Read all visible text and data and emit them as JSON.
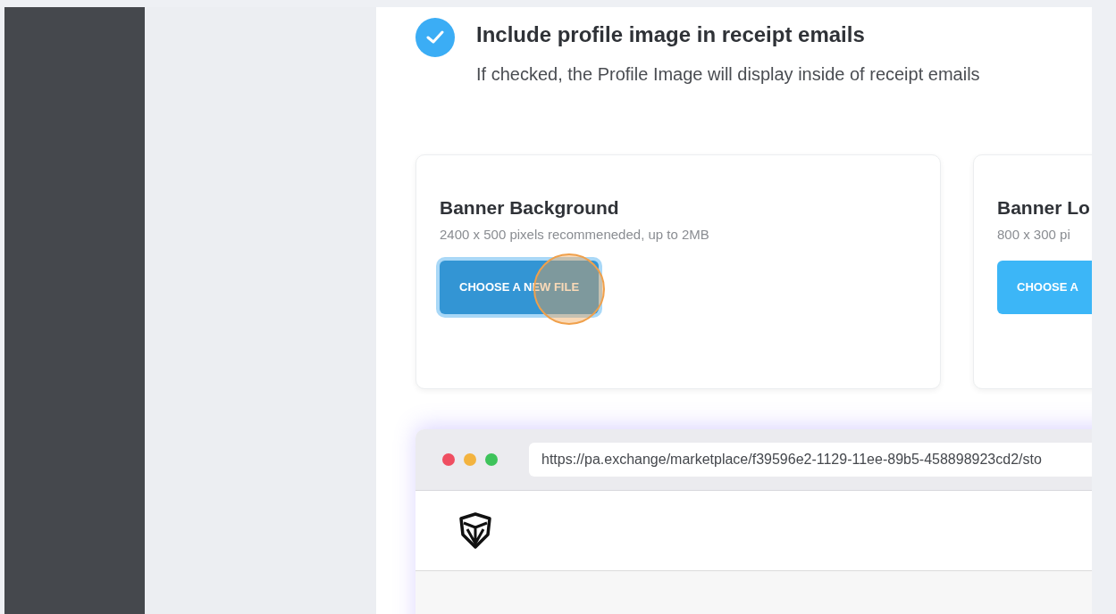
{
  "profile_option": {
    "checked": true,
    "label": "Include profile image in receipt emails",
    "description": "If checked, the Profile Image will display inside of receipt emails"
  },
  "cards": [
    {
      "title": "Banner Background",
      "hint": "2400 x 500 pixels recommeneded, up to 2MB",
      "button": "CHOOSE A NEW FILE",
      "pressed": true
    },
    {
      "title": "Banner Lo",
      "hint": "800 x 300 pi",
      "button": "CHOOSE A",
      "pressed": false
    }
  ],
  "preview": {
    "url": "https://pa.exchange/marketplace/f39596e2-1129-11ee-89b5-458898923cd2/sto"
  }
}
